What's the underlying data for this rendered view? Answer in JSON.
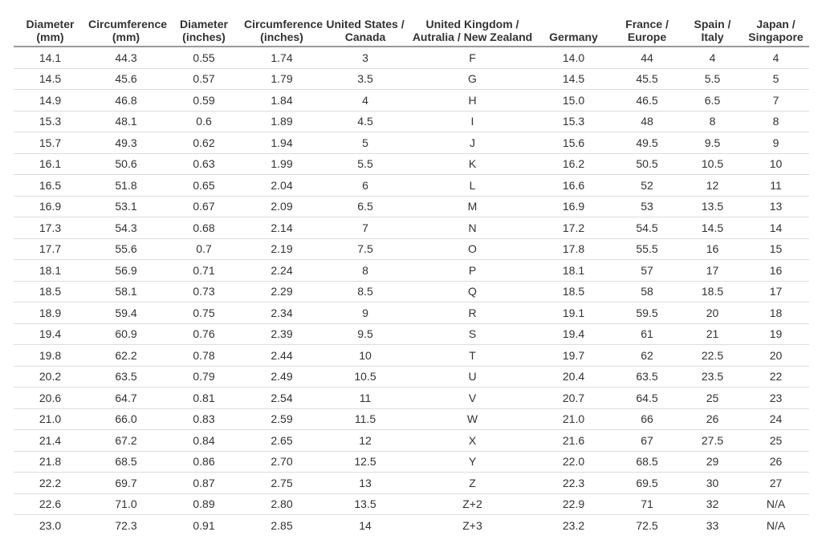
{
  "table": {
    "headers": [
      [
        "Diameter",
        "(mm)"
      ],
      [
        "Circumference",
        "(mm)"
      ],
      [
        "Diameter",
        "(inches)"
      ],
      [
        "Circumference",
        "(inches)"
      ],
      [
        "United States /",
        "Canada"
      ],
      [
        "United Kingdom /",
        "Autralia / New Zealand"
      ],
      [
        "",
        "Germany"
      ],
      [
        "France /",
        "Europe"
      ],
      [
        "Spain /",
        "Italy"
      ],
      [
        "Japan /",
        "Singapore"
      ]
    ],
    "rows": [
      [
        "14.1",
        "44.3",
        "0.55",
        "1.74",
        "3",
        "F",
        "14.0",
        "44",
        "4",
        "4"
      ],
      [
        "14.5",
        "45.6",
        "0.57",
        "1.79",
        "3.5",
        "G",
        "14.5",
        "45.5",
        "5.5",
        "5"
      ],
      [
        "14.9",
        "46.8",
        "0.59",
        "1.84",
        "4",
        "H",
        "15.0",
        "46.5",
        "6.5",
        "7"
      ],
      [
        "15.3",
        "48.1",
        "0.6",
        "1.89",
        "4.5",
        "I",
        "15.3",
        "48",
        "8",
        "8"
      ],
      [
        "15.7",
        "49.3",
        "0.62",
        "1.94",
        "5",
        "J",
        "15.6",
        "49.5",
        "9.5",
        "9"
      ],
      [
        "16.1",
        "50.6",
        "0.63",
        "1.99",
        "5.5",
        "K",
        "16.2",
        "50.5",
        "10.5",
        "10"
      ],
      [
        "16.5",
        "51.8",
        "0.65",
        "2.04",
        "6",
        "L",
        "16.6",
        "52",
        "12",
        "11"
      ],
      [
        "16.9",
        "53.1",
        "0.67",
        "2.09",
        "6.5",
        "M",
        "16.9",
        "53",
        "13.5",
        "13"
      ],
      [
        "17.3",
        "54.3",
        "0.68",
        "2.14",
        "7",
        "N",
        "17.2",
        "54.5",
        "14.5",
        "14"
      ],
      [
        "17.7",
        "55.6",
        "0.7",
        "2.19",
        "7.5",
        "O",
        "17.8",
        "55.5",
        "16",
        "15"
      ],
      [
        "18.1",
        "56.9",
        "0.71",
        "2.24",
        "8",
        "P",
        "18.1",
        "57",
        "17",
        "16"
      ],
      [
        "18.5",
        "58.1",
        "0.73",
        "2.29",
        "8.5",
        "Q",
        "18.5",
        "58",
        "18.5",
        "17"
      ],
      [
        "18.9",
        "59.4",
        "0.75",
        "2.34",
        "9",
        "R",
        "19.1",
        "59.5",
        "20",
        "18"
      ],
      [
        "19.4",
        "60.9",
        "0.76",
        "2.39",
        "9.5",
        "S",
        "19.4",
        "61",
        "21",
        "19"
      ],
      [
        "19.8",
        "62.2",
        "0.78",
        "2.44",
        "10",
        "T",
        "19.7",
        "62",
        "22.5",
        "20"
      ],
      [
        "20.2",
        "63.5",
        "0.79",
        "2.49",
        "10.5",
        "U",
        "20.4",
        "63.5",
        "23.5",
        "22"
      ],
      [
        "20.6",
        "64.7",
        "0.81",
        "2.54",
        "11",
        "V",
        "20.7",
        "64.5",
        "25",
        "23"
      ],
      [
        "21.0",
        "66.0",
        "0.83",
        "2.59",
        "11.5",
        "W",
        "21.0",
        "66",
        "26",
        "24"
      ],
      [
        "21.4",
        "67.2",
        "0.84",
        "2.65",
        "12",
        "X",
        "21.6",
        "67",
        "27.5",
        "25"
      ],
      [
        "21.8",
        "68.5",
        "0.86",
        "2.70",
        "12.5",
        "Y",
        "22.0",
        "68.5",
        "29",
        "26"
      ],
      [
        "22.2",
        "69.7",
        "0.87",
        "2.75",
        "13",
        "Z",
        "22.3",
        "69.5",
        "30",
        "27"
      ],
      [
        "22.6",
        "71.0",
        "0.89",
        "2.80",
        "13.5",
        "Z+2",
        "22.9",
        "71",
        "32",
        "N/A"
      ],
      [
        "23.0",
        "72.3",
        "0.91",
        "2.85",
        "14",
        "Z+3",
        "23.2",
        "72.5",
        "33",
        "N/A"
      ]
    ]
  }
}
